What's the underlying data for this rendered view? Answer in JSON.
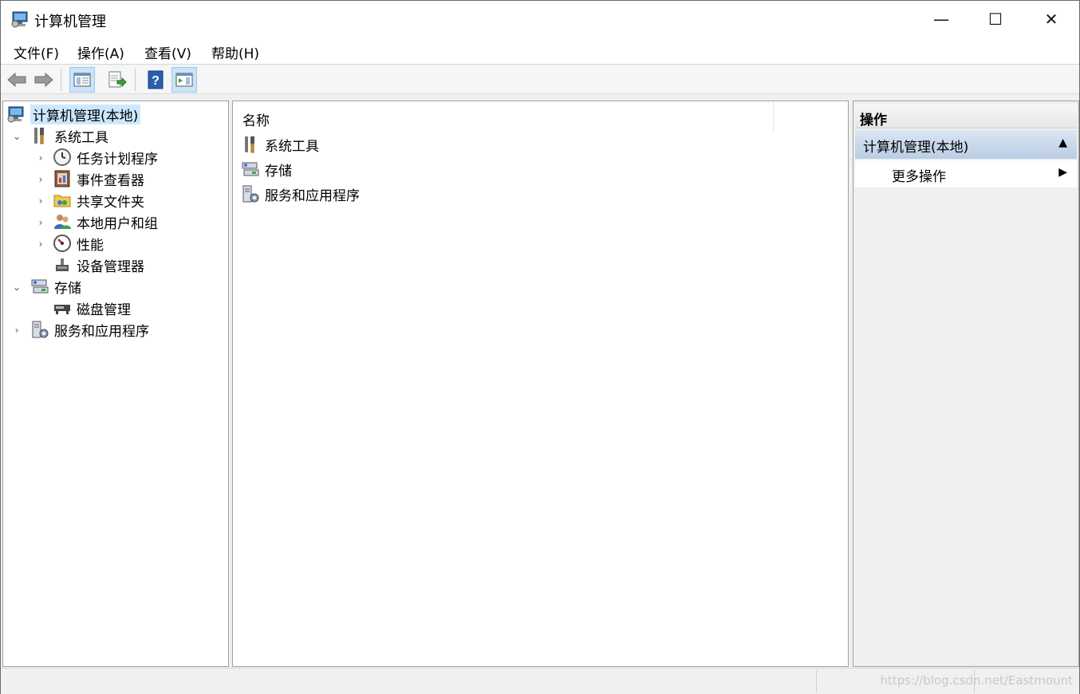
{
  "window": {
    "title": "计算机管理",
    "controls": {
      "minimize": "—",
      "maximize": "☐",
      "close": "✕"
    }
  },
  "menu": {
    "items": [
      {
        "label": "文件(F)"
      },
      {
        "label": "操作(A)"
      },
      {
        "label": "查看(V)"
      },
      {
        "label": "帮助(H)"
      }
    ]
  },
  "toolbar": {
    "buttons": [
      "back-icon",
      "forward-icon",
      "show-hide-tree-icon",
      "export-list-icon",
      "help-icon",
      "show-hide-action-pane-icon"
    ]
  },
  "tree": {
    "root": {
      "label": "计算机管理(本地)"
    },
    "items": [
      {
        "label": "系统工具",
        "expanded": true
      },
      {
        "label": "任务计划程序"
      },
      {
        "label": "事件查看器"
      },
      {
        "label": "共享文件夹"
      },
      {
        "label": "本地用户和组"
      },
      {
        "label": "性能"
      },
      {
        "label": "设备管理器"
      },
      {
        "label": "存储",
        "expanded": true
      },
      {
        "label": "磁盘管理"
      },
      {
        "label": "服务和应用程序"
      }
    ]
  },
  "list": {
    "column_header": "名称",
    "rows": [
      {
        "label": "系统工具"
      },
      {
        "label": "存储"
      },
      {
        "label": "服务和应用程序"
      }
    ]
  },
  "actions": {
    "header": "操作",
    "group_label": "计算机管理(本地)",
    "items": [
      {
        "label": "更多操作"
      }
    ]
  },
  "status": {
    "watermark": "https://blog.csdn.net/Eastmount"
  },
  "colors": {
    "selection": "#cce8ff",
    "group_header": "#b9cde3",
    "border": "#a0a0a0"
  }
}
